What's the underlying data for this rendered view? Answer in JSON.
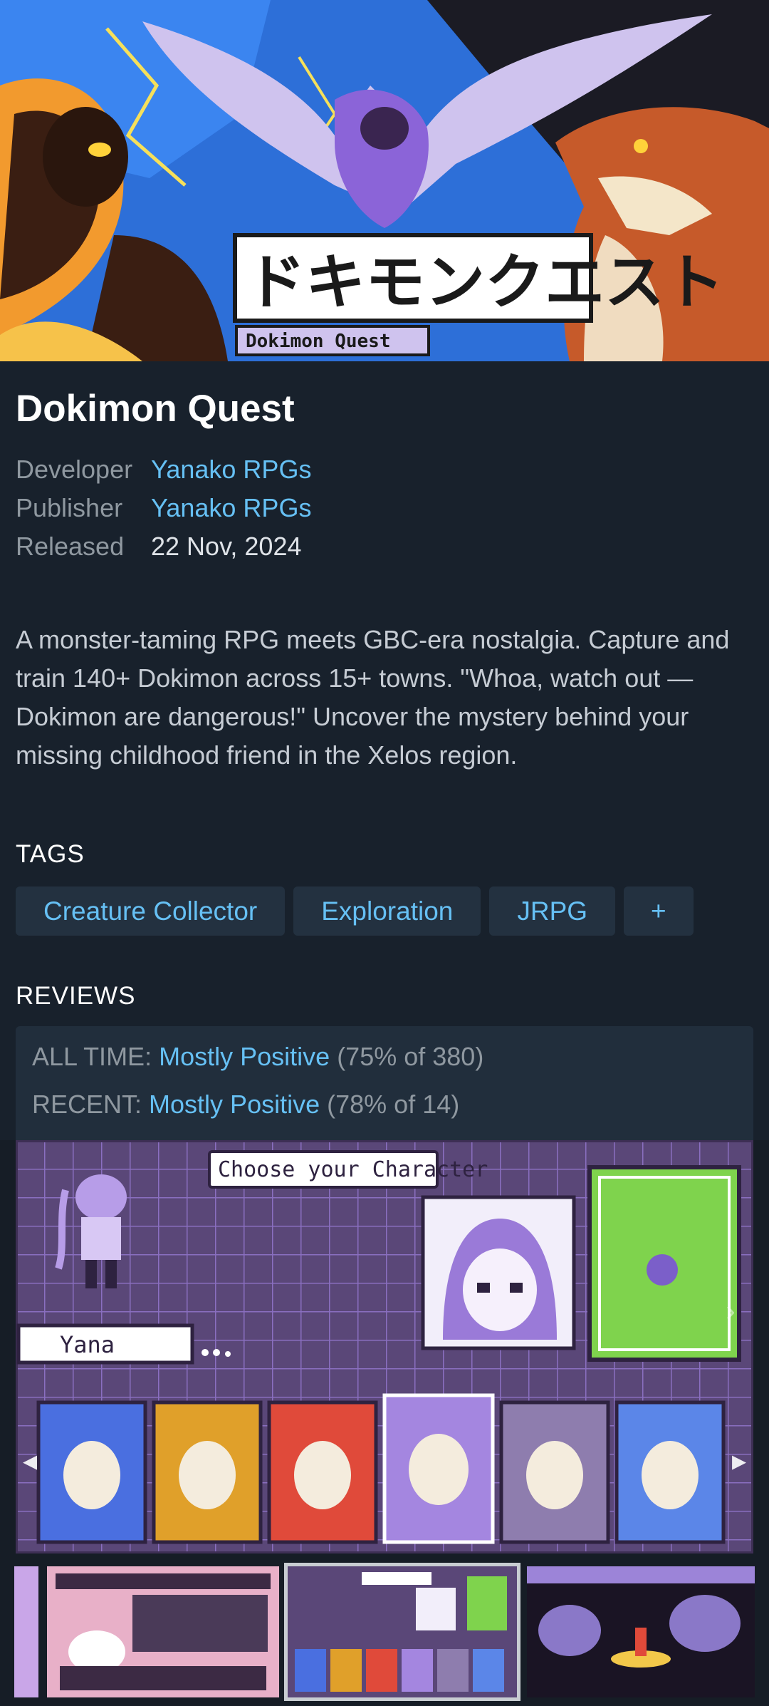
{
  "game": {
    "logo_jp": "ドキモンクエスト",
    "logo_en": "Dokimon Quest",
    "title": "Dokimon Quest",
    "developer_label": "Developer",
    "developer": "Yanako RPGs",
    "publisher_label": "Publisher",
    "publisher": "Yanako RPGs",
    "released_label": "Released",
    "released": "22 Nov, 2024",
    "description": "A monster-taming RPG meets GBC-era nostalgia. Capture and train 140+ Dokimon across 15+ towns. \"Whoa, watch out — Dokimon are dangerous!\" Uncover the mystery behind your missing childhood friend in the Xelos region."
  },
  "tags": {
    "heading": "TAGS",
    "items": [
      "Creature Collector",
      "Exploration",
      "JRPG",
      "+"
    ]
  },
  "reviews": {
    "heading": "REVIEWS",
    "all_time_label": "ALL TIME:",
    "all_time_summary": "Mostly Positive",
    "all_time_detail": "(75% of 380)",
    "recent_label": "RECENT:",
    "recent_summary": "Mostly Positive",
    "recent_detail": "(78% of 14)"
  },
  "screenshot": {
    "banner": "Choose your Character",
    "name_field": "Yana"
  },
  "colors": {
    "accent": "#66c0f4",
    "background": "#161d26",
    "panel": "#212e3c",
    "tag_bg": "#233140"
  }
}
